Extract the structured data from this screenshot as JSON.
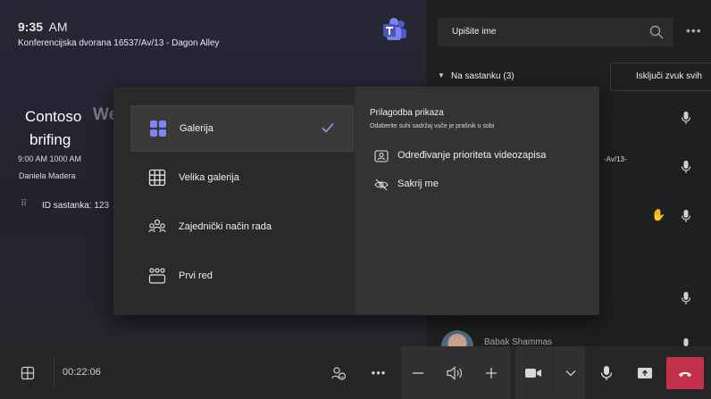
{
  "header": {
    "time": "9:35",
    "ampm": "AM",
    "room": "Konferencijska dvorana 16537/Av/13 - Dagon Alley"
  },
  "meeting": {
    "org": "Contoso",
    "org_ghost": "We",
    "topic": "brifing",
    "time_range": "9:00 AM 1000 AM",
    "organizer": "Daniela Madera",
    "meeting_id": "ID sastanka: 123"
  },
  "roster": {
    "search_placeholder": "Upišite ime",
    "section_title": "Na sastanku (3)",
    "mute_all_label": "Isključi zvuk svih",
    "ghost_text": "-Av/13-",
    "participant_name": "Babak Shammas"
  },
  "layout_menu": {
    "items": [
      {
        "label": "Galerija",
        "icon": "gallery-icon",
        "selected": true
      },
      {
        "label": "Velika galerija",
        "icon": "large-gallery-icon"
      },
      {
        "label": "Zajednički način rada",
        "icon": "together-mode-icon"
      },
      {
        "label": "Prvi red",
        "icon": "front-row-icon"
      }
    ],
    "adjust_title": "Prilagodba prikaza",
    "adjust_subtitle": "Odaberite suhi sadržaj vuče je prašnik u sobi",
    "adjust_items": [
      {
        "label": "Određivanje prioriteta videozapisa",
        "icon": "prioritize-video-icon"
      },
      {
        "label": "Sakrij me",
        "icon": "hide-me-icon"
      }
    ]
  },
  "toolbar": {
    "timer": "00:22:06"
  },
  "colors": {
    "accent": "#7f85f5",
    "hangup": "#c4314b",
    "raised_hand": "#d79b25"
  }
}
